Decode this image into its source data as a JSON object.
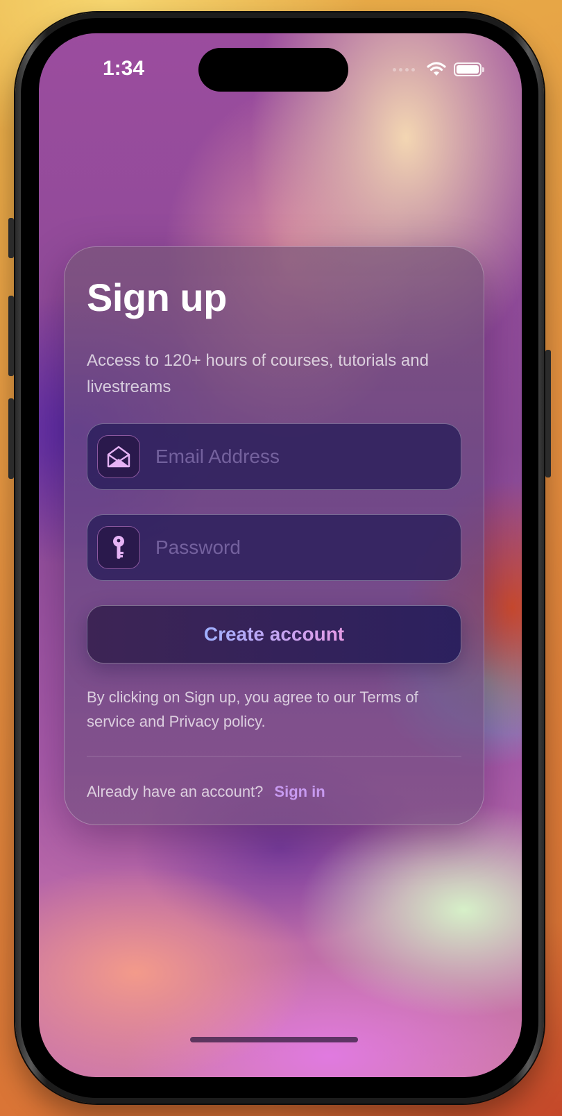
{
  "status_bar": {
    "time": "1:34"
  },
  "signup": {
    "title": "Sign up",
    "subtitle": "Access to 120+ hours of courses, tutorials and livestreams",
    "email_placeholder": "Email Address",
    "password_placeholder": "Password",
    "create_button_label": "Create account",
    "legal_text": "By clicking on Sign up, you agree to our Terms of service and Privacy policy.",
    "signin_prompt": "Already have an account?",
    "signin_link": "Sign in"
  },
  "icons": {
    "email": "envelope-open-icon",
    "password": "key-icon",
    "wifi": "wifi-icon",
    "battery": "battery-icon",
    "signal": "cellular-signal-icon"
  },
  "colors": {
    "accent": "#c79af0",
    "button_gradient_start": "#9fb0ff",
    "button_gradient_end": "#e59be6",
    "field_background": "#261c58",
    "icon_fill": "#e6b3f5"
  }
}
